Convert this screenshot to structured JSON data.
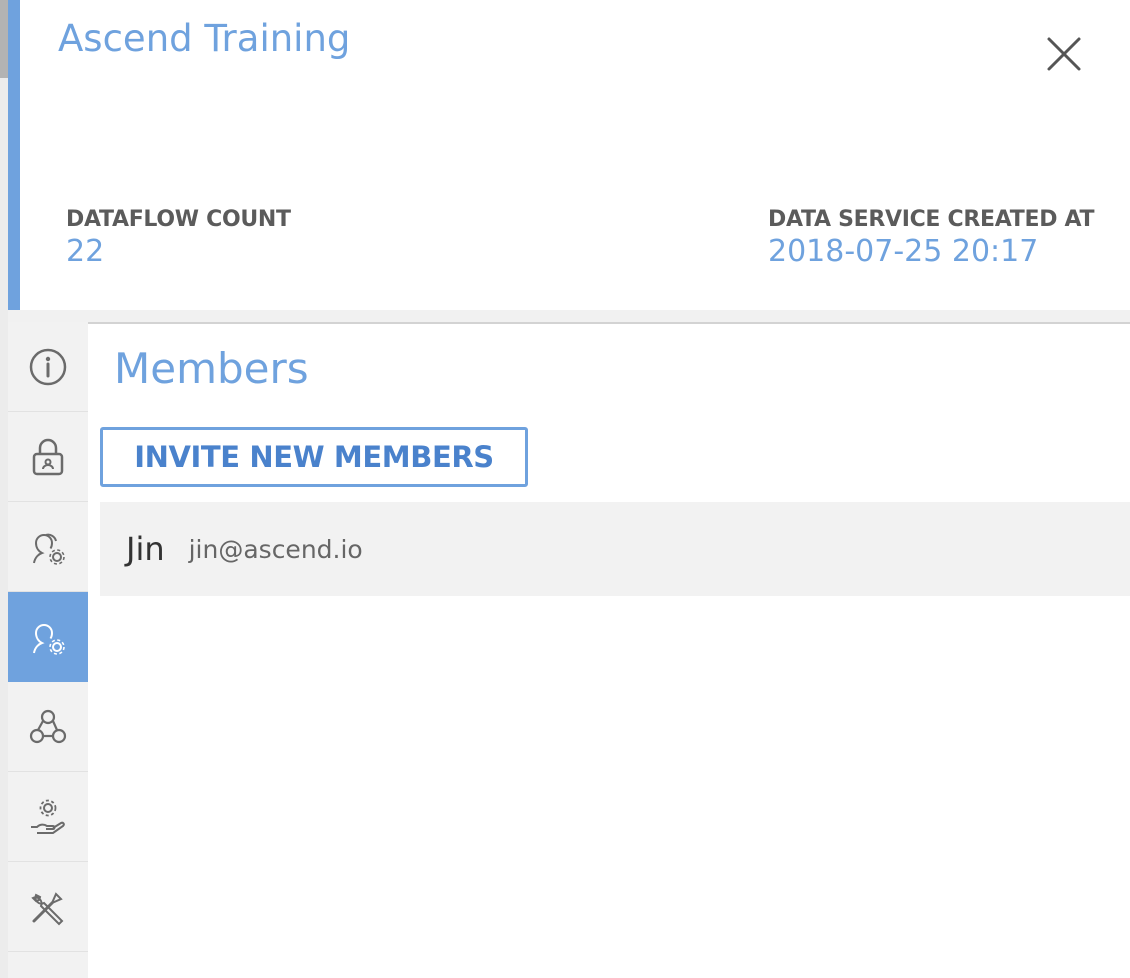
{
  "panel": {
    "title": "Ascend Training",
    "close_icon": "close-icon"
  },
  "stats": {
    "dataflow_count_label": "DATAFLOW COUNT",
    "dataflow_count_value": "22",
    "created_at_label": "DATA SERVICE CREATED AT",
    "created_at_value": "2018-07-25 20:17"
  },
  "sidebar": {
    "items": [
      {
        "icon": "info-icon",
        "active": false
      },
      {
        "icon": "lock-icon",
        "active": false
      },
      {
        "icon": "users-settings-icon",
        "active": false
      },
      {
        "icon": "user-settings-icon",
        "active": true
      },
      {
        "icon": "webhook-icon",
        "active": false
      },
      {
        "icon": "service-hand-icon",
        "active": false
      },
      {
        "icon": "tools-icon",
        "active": false
      }
    ]
  },
  "members": {
    "heading": "Members",
    "invite_label": "INVITE NEW MEMBERS",
    "list": [
      {
        "name": "Jin",
        "email": "jin@ascend.io"
      }
    ]
  },
  "colors": {
    "accent": "#6fa2de",
    "button_text": "#4a82cc",
    "label_gray": "#5b5b5b",
    "sidebar_bg": "#f2f2f2"
  }
}
